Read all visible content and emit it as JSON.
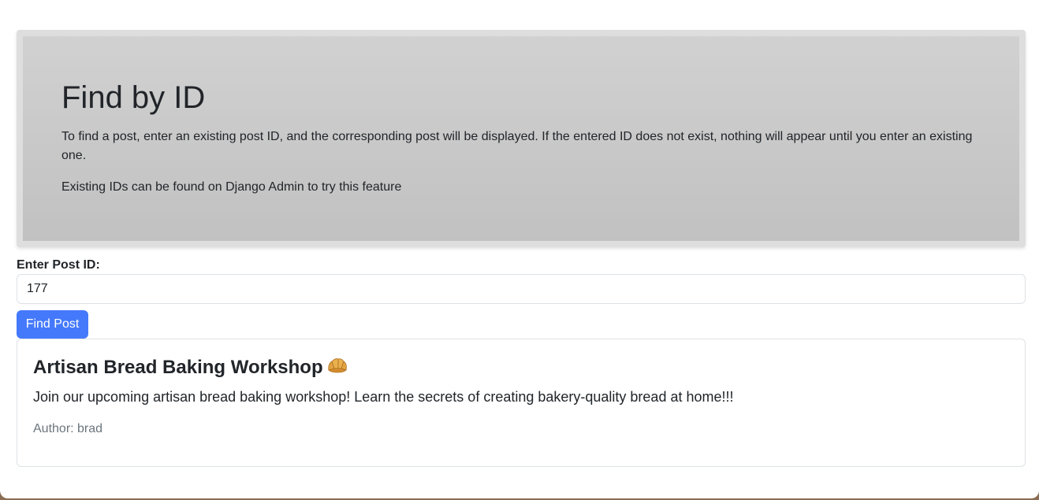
{
  "hero": {
    "title": "Find by ID",
    "description": "To find a post, enter an existing post ID, and the corresponding post will be displayed. If the entered ID does not exist, nothing will appear until you enter an existing one.",
    "hint": "Existing IDs can be found on Django Admin to try this feature"
  },
  "form": {
    "label": "Enter Post ID:",
    "input_value": "177",
    "button_label": "Find Post"
  },
  "post": {
    "title": "Artisan Bread Baking Workshop",
    "title_icon": "croissant-icon",
    "body": "Join our upcoming artisan bread baking workshop! Learn the secrets of creating bakery-quality bread at home!!!",
    "author": "Author: brad"
  },
  "colors": {
    "primary": "#4479fb",
    "hero_background": "#c8c8c8",
    "muted_text": "#6c757d"
  }
}
